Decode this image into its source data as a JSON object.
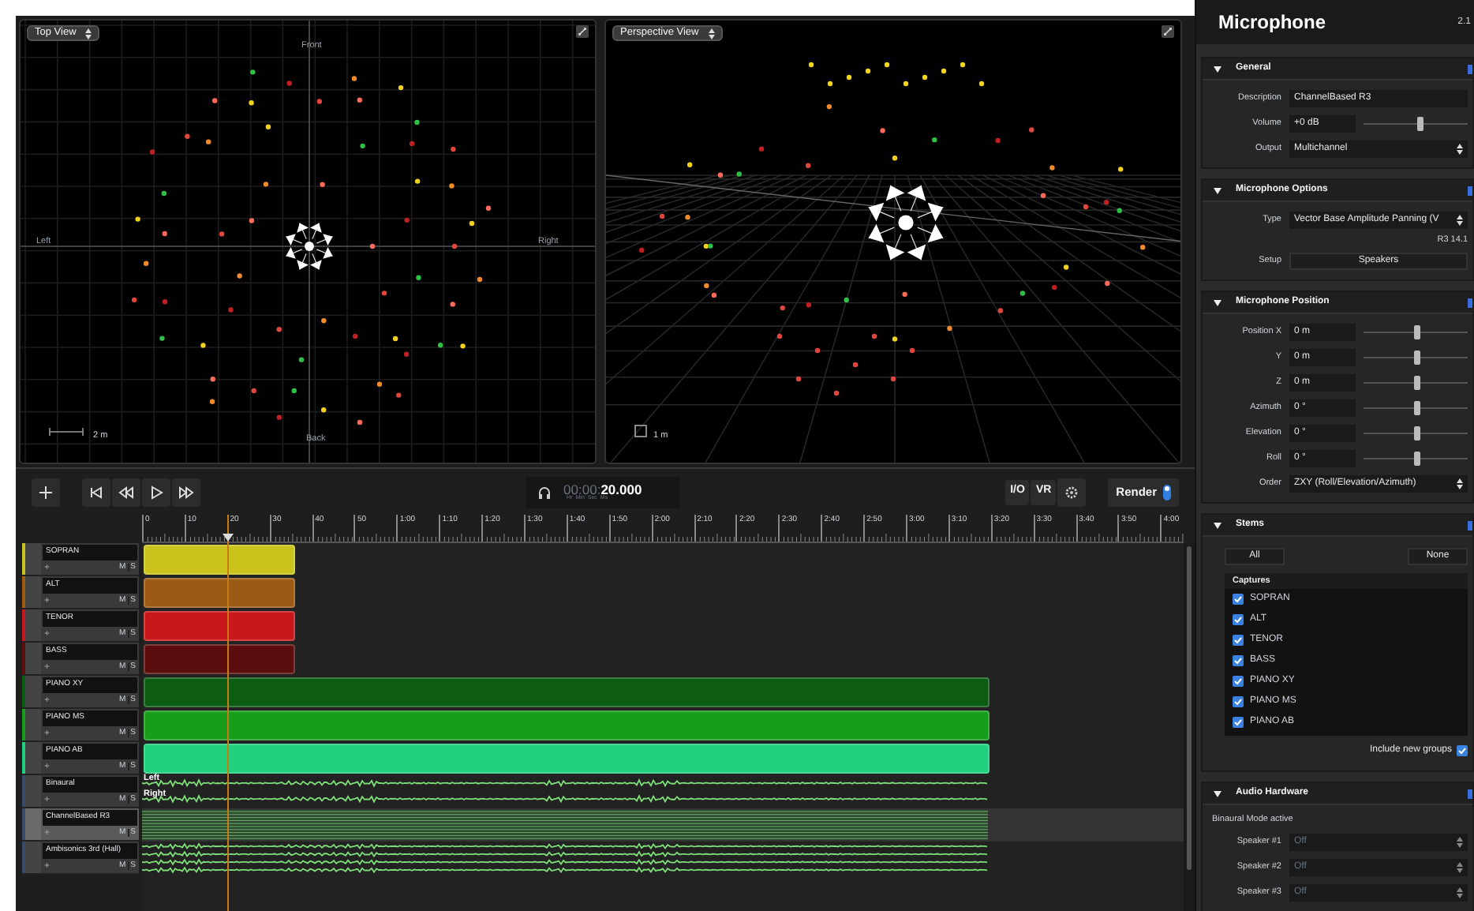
{
  "views": [
    {
      "kind": "top",
      "title": "Top View",
      "front": "Front",
      "back": "Back",
      "left": "Left",
      "right": "Right",
      "scale": "2 m"
    },
    {
      "kind": "perspective",
      "title": "Perspective View",
      "scale": "1 m"
    }
  ],
  "transport": {
    "timecode_dim": "00:00:",
    "timecode": "20.000",
    "units": [
      "Hr",
      "Min",
      "Sec",
      "Ms"
    ],
    "buttons": [
      "I/O",
      "VR"
    ],
    "render": "Render",
    "render_on": true
  },
  "ruler": [
    "0",
    "10",
    "20",
    "30",
    "40",
    "50",
    "1:00",
    "1:10",
    "1:20",
    "1:30",
    "1:40",
    "1:50",
    "2:00",
    "2:10",
    "2:20",
    "2:30",
    "2:40",
    "2:50",
    "3:00",
    "3:10",
    "3:20",
    "3:30",
    "3:40",
    "3:50",
    "4:00"
  ],
  "playhead": {
    "level": 0.083
  },
  "tracks": [
    {
      "name": "SOPRAN",
      "add": "+",
      "mute": "M",
      "solo": "S",
      "color": "#c9c31c",
      "kind": "clip",
      "level": 0.149,
      "selected": false
    },
    {
      "name": "ALT",
      "add": "+",
      "mute": "M",
      "solo": "S",
      "color": "#9c5b14",
      "kind": "clip",
      "level": 0.149,
      "selected": false
    },
    {
      "name": "TENOR",
      "add": "+",
      "mute": "M",
      "solo": "S",
      "color": "#c8181b",
      "kind": "clip",
      "level": 0.149,
      "selected": false
    },
    {
      "name": "BASS",
      "add": "+",
      "mute": "M",
      "solo": "S",
      "color": "#5c0d0d",
      "kind": "clip",
      "level": 0.149,
      "selected": false
    },
    {
      "name": "PIANO XY",
      "add": "+",
      "mute": "M",
      "solo": "S",
      "color": "#0d5c14",
      "kind": "clip",
      "level": 0.83,
      "selected": false
    },
    {
      "name": "PIANO MS",
      "add": "+",
      "mute": "M",
      "solo": "S",
      "color": "#189c1c",
      "kind": "clip",
      "level": 0.83,
      "selected": false
    },
    {
      "name": "PIANO AB",
      "add": "+",
      "mute": "M",
      "solo": "S",
      "color": "#20d07c",
      "kind": "clip",
      "level": 0.83,
      "selected": false
    },
    {
      "name": "Binaural",
      "add": "+",
      "mute": "M",
      "solo": "S",
      "color": "#3a4a6c",
      "kind": "stereo",
      "channels": [
        "Left",
        "Right"
      ],
      "level": 0.83,
      "selected": false
    },
    {
      "name": "ChannelBased R3",
      "add": "+",
      "mute": "M",
      "solo": "S",
      "color": "#3a4a6c",
      "kind": "multichannel",
      "level": 0.83,
      "selected": true
    },
    {
      "name": "Ambisonics 3rd (Hall)",
      "add": "+",
      "mute": "M",
      "solo": "S",
      "color": "#3a4a6c",
      "kind": "ambisonic",
      "level": 0.83,
      "selected": false
    }
  ],
  "panel": {
    "title": "Microphone",
    "version": "2.1",
    "sections": [
      {
        "title": "General",
        "expanded": true,
        "rows": [
          {
            "kind": "field",
            "label": "Description",
            "value": "ChannelBased R3"
          },
          {
            "kind": "slider",
            "label": "Volume",
            "value": "+0 dB",
            "level": 0.55
          },
          {
            "kind": "select",
            "label": "Output",
            "value": "Multichannel",
            "disabled": false
          }
        ]
      },
      {
        "title": "Microphone Options",
        "expanded": true,
        "rows": [
          {
            "kind": "select",
            "label": "Type",
            "value": "Vector Base Amplitude Panning (V",
            "disabled": false
          },
          {
            "kind": "note",
            "text": "R3 14.1"
          },
          {
            "kind": "button",
            "label": "Setup",
            "value": "Speakers"
          }
        ]
      },
      {
        "title": "Microphone Position",
        "expanded": true,
        "rows": [
          {
            "kind": "slider",
            "label": "Position X",
            "value": "0 m",
            "level": 0.52
          },
          {
            "kind": "slider",
            "label": "Y",
            "value": "0 m",
            "level": 0.52
          },
          {
            "kind": "slider",
            "label": "Z",
            "value": "0 m",
            "level": 0.52
          },
          {
            "kind": "slider",
            "label": "Azimuth",
            "value": "0 °",
            "level": 0.52
          },
          {
            "kind": "slider",
            "label": "Elevation",
            "value": "0 °",
            "level": 0.52
          },
          {
            "kind": "slider",
            "label": "Roll",
            "value": "0 °",
            "level": 0.52
          },
          {
            "kind": "select",
            "label": "Order",
            "value": "ZXY (Roll/Elevation/Azimuth)",
            "disabled": false
          }
        ]
      },
      {
        "title": "Stems",
        "expanded": true,
        "rows": [
          {
            "kind": "pair",
            "items": [
              "All",
              "None"
            ]
          },
          {
            "kind": "list",
            "title": "Captures",
            "items": [
              {
                "label": "SOPRAN",
                "checked": true
              },
              {
                "label": "ALT",
                "checked": true
              },
              {
                "label": "TENOR",
                "checked": true
              },
              {
                "label": "BASS",
                "checked": true
              },
              {
                "label": "PIANO XY",
                "checked": true
              },
              {
                "label": "PIANO MS",
                "checked": true
              },
              {
                "label": "PIANO AB",
                "checked": true
              }
            ]
          },
          {
            "kind": "check",
            "label": "Include new groups",
            "checked": true
          }
        ]
      },
      {
        "title": "Audio Hardware",
        "expanded": true,
        "rows": [
          {
            "kind": "text",
            "text": "Binaural Mode active"
          },
          {
            "kind": "select",
            "label": "Speaker #1",
            "value": "Off",
            "disabled": true
          },
          {
            "kind": "select",
            "label": "Speaker #2",
            "value": "Off",
            "disabled": true
          },
          {
            "kind": "select",
            "label": "Speaker #3",
            "value": "Off",
            "disabled": true
          }
        ]
      }
    ]
  }
}
